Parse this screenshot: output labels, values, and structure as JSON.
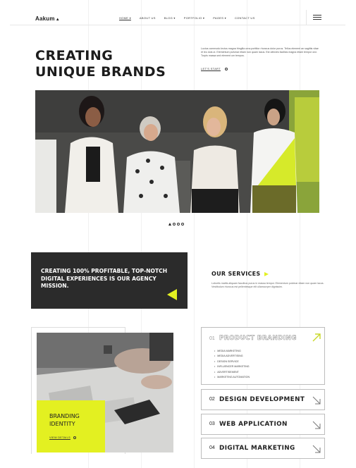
{
  "header": {
    "logo": "Aakum",
    "logo_mark": "▲",
    "nav": [
      {
        "label": "HOME ▾"
      },
      {
        "label": "ABOUT US"
      },
      {
        "label": "BLOG ▾"
      },
      {
        "label": "PORTFOLIO ▾"
      },
      {
        "label": "PAGES ▾"
      },
      {
        "label": "CONTACT US"
      }
    ]
  },
  "hero": {
    "title_line1": "CREATING",
    "title_line2": "UNIQUE BRANDS",
    "text": "Luctus commodo lectus magna fringilla urna porttitor rhoncus dolor purus. Tellus element an sagittis vitae et leo duis ut. Elementum pulvinar etiam non quam lacus. Est ultricies facilisis magna etiam tempor orci. Turpis massa sed element um tempus.",
    "cta": "LET'S START"
  },
  "mission": {
    "text": "CREATING 100% PROFITABLE, TOP-NOTCH DIGITAL EXPERIENCES IS OUR AGENCY MISSION."
  },
  "services": {
    "title": "OUR SERVICES",
    "text": "Lobortis mattis aliquam faucibus purus in massa tempor. Elementum pulvinar etiam non quam lacus. Vestibulum rhoncus est pellentesque elit ullamcorper dignissim.",
    "items": [
      {
        "num": "01",
        "name": "PRODUCT BRANDING"
      },
      {
        "num": "02",
        "name": "DESIGN DEVELOPMENT"
      },
      {
        "num": "03",
        "name": "WEB APPLICATION"
      },
      {
        "num": "04",
        "name": "DIGITAL MARKETING"
      }
    ],
    "branding_sub": [
      "MEDIA MARKETING",
      "MEDIA ADVERTISING",
      "DESIGN SERVICE",
      "INFLUENCER MARKETING",
      "ADVERTISEMENT",
      "MARKETING AUTOMATION"
    ]
  },
  "branding_card": {
    "title_line1": "BRANDING",
    "title_line2": "IDENTITY",
    "cta": "VIEW DETAILS"
  },
  "colors": {
    "accent": "#e3f021",
    "dark": "#2b2b2b"
  }
}
